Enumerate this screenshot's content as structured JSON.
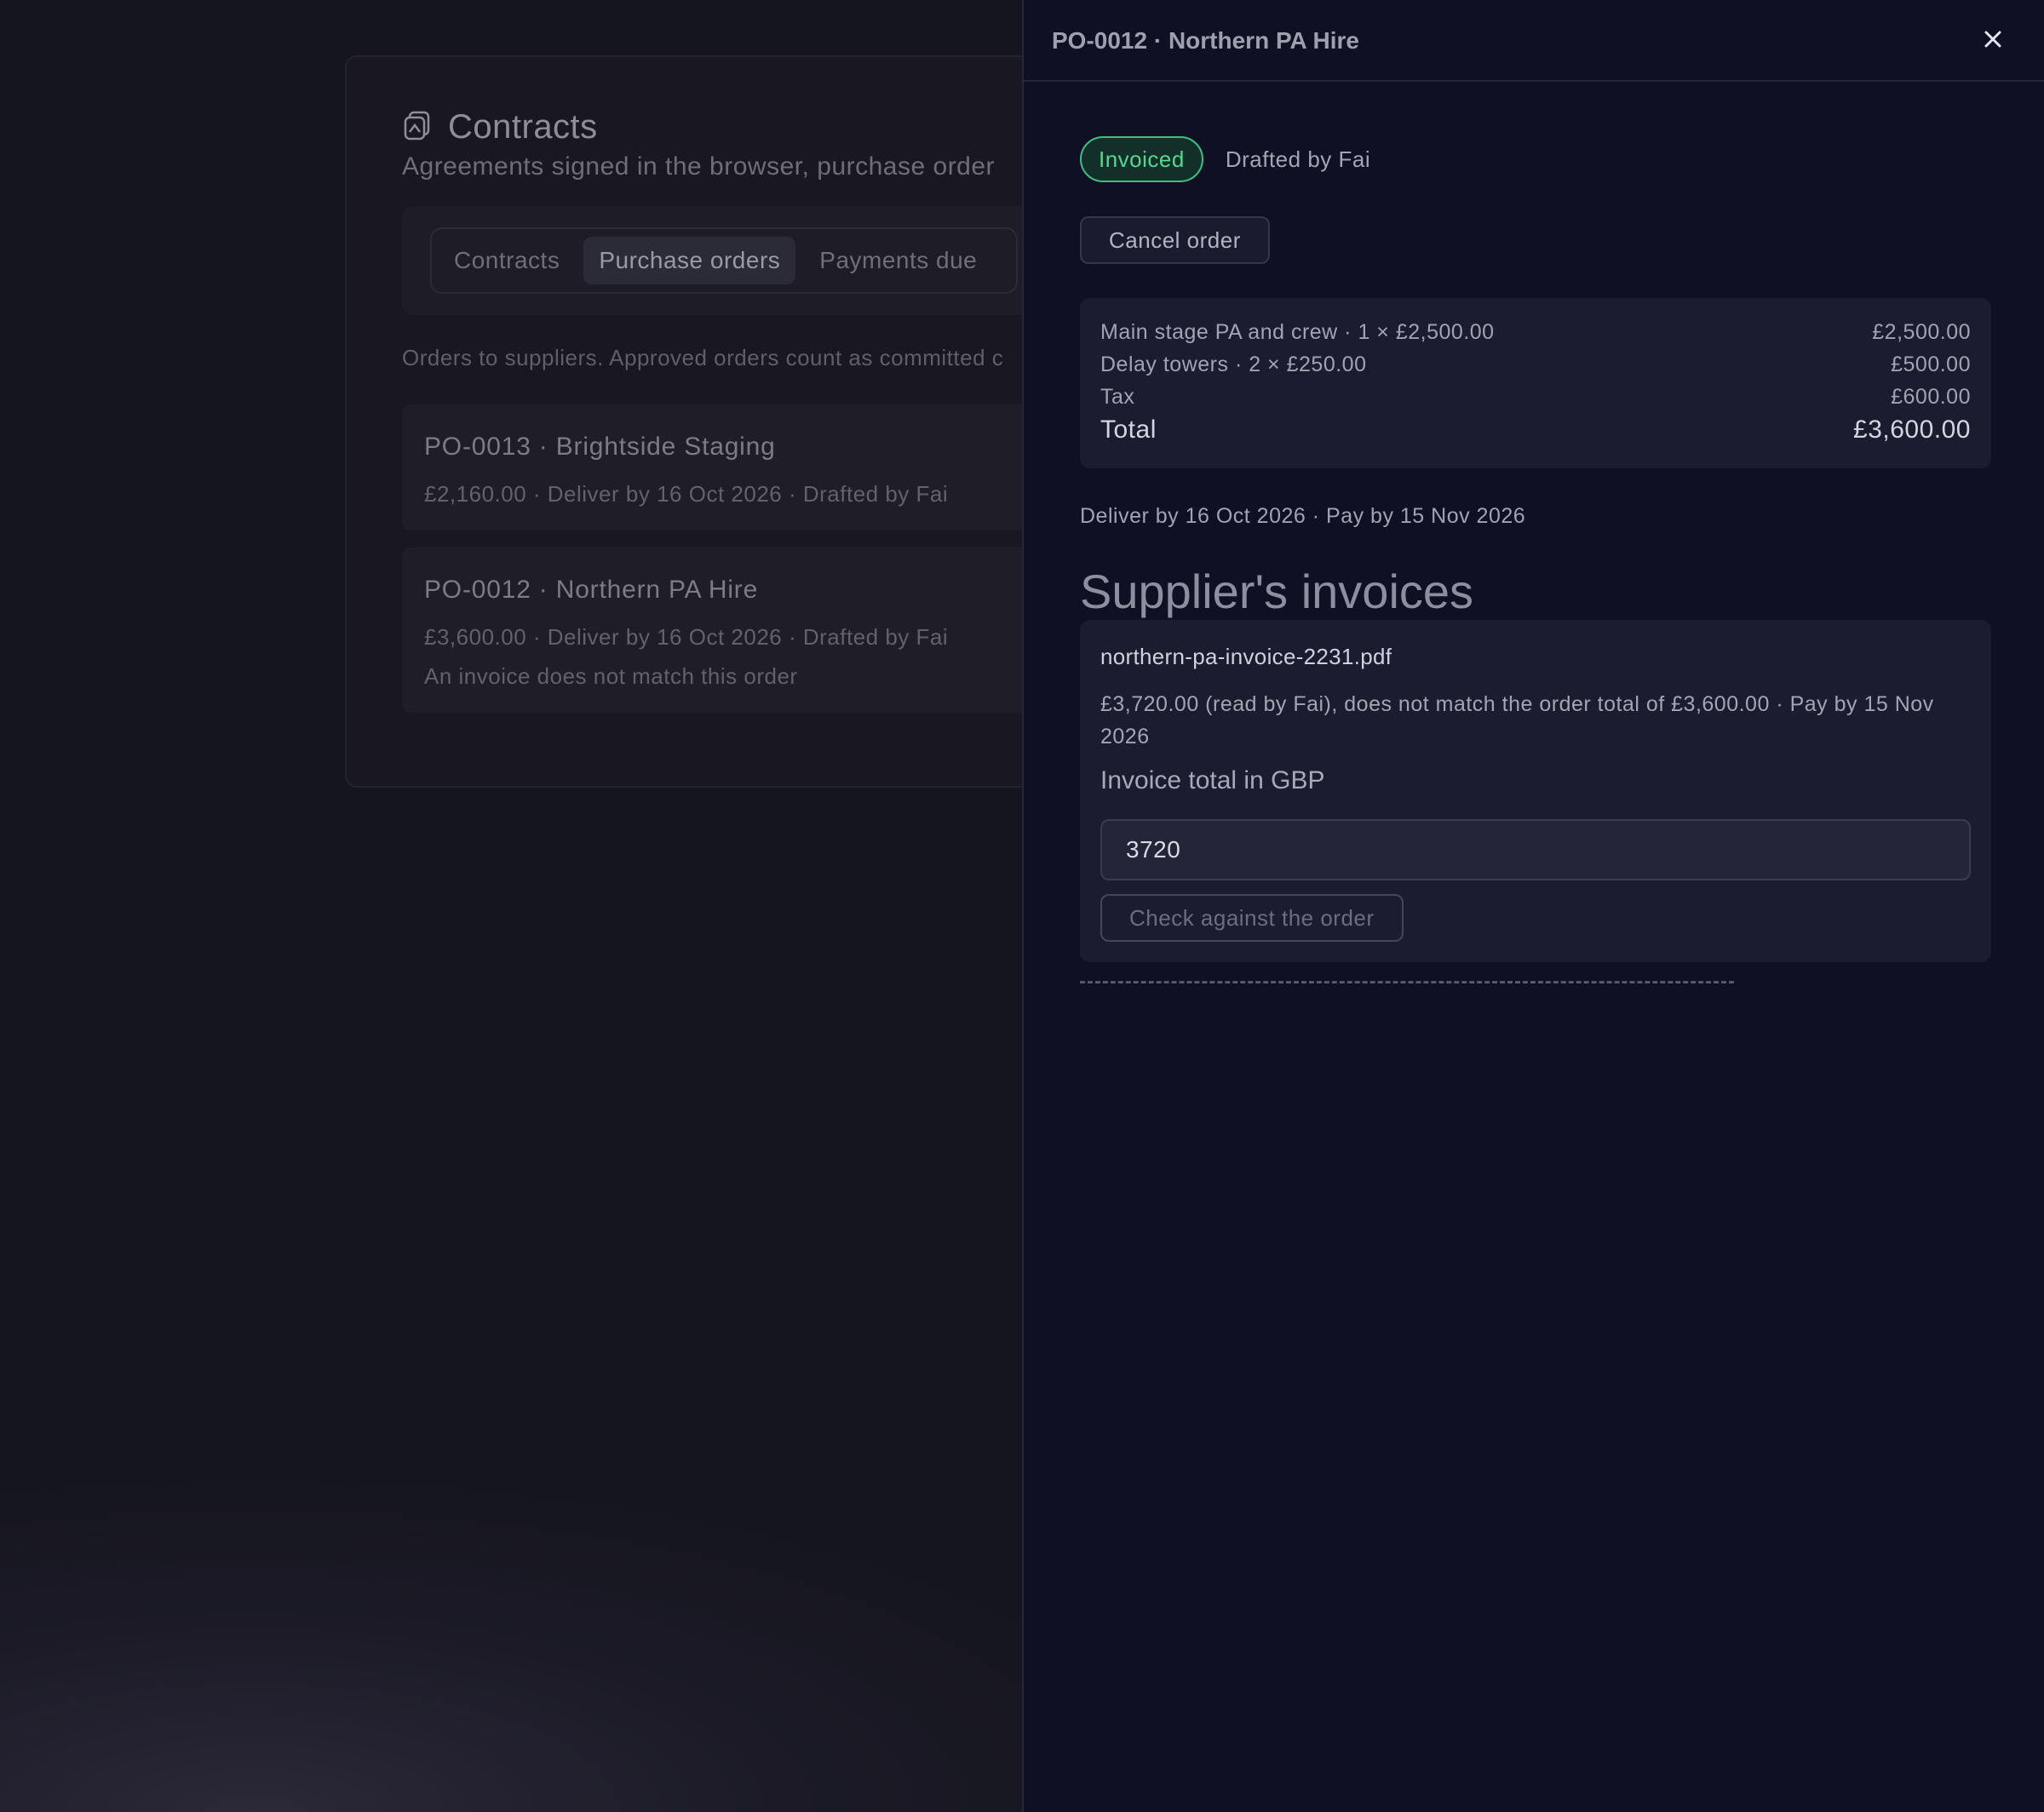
{
  "background": {
    "card": {
      "title": "Contracts",
      "subtitle": "Agreements signed in the browser, purchase order",
      "tabs": [
        "Contracts",
        "Purchase orders",
        "Payments due"
      ],
      "active_tab": "Purchase orders",
      "orders_description": "Orders to suppliers. Approved orders count as committed c",
      "orders": [
        {
          "title": "PO-0013 · Brightside Staging",
          "meta": "£2,160.00 · Deliver by 16 Oct 2026 · Drafted by Fai",
          "warning": ""
        },
        {
          "title": "PO-0012 · Northern PA Hire",
          "meta": "£3,600.00 · Deliver by 16 Oct 2026 · Drafted by Fai",
          "warning": "An invoice does not match this order"
        }
      ]
    }
  },
  "drawer": {
    "title": "PO-0012 · Northern PA Hire",
    "close_icon": "close-icon",
    "status": "Invoiced",
    "drafted": "Drafted by Fai",
    "cancel_label": "Cancel order",
    "lines": [
      {
        "label": "Main stage PA and crew · 1 × £2,500.00",
        "amount": "£2,500.00"
      },
      {
        "label": "Delay towers · 2 × £250.00",
        "amount": "£500.00"
      },
      {
        "label": "Tax",
        "amount": "£600.00"
      }
    ],
    "total": {
      "label": "Total",
      "amount": "£3,600.00"
    },
    "dates": "Deliver by 16 Oct 2026 · Pay by 15 Nov 2026",
    "invoices_heading": "Supplier's invoices",
    "invoice": {
      "file": "northern-pa-invoice-2231.pdf",
      "description": "£3,720.00 (read by Fai), does not match the order total of £3,600.00 · Pay by 15 Nov 2026",
      "field_label": "Invoice total in GBP",
      "field_value": "3720",
      "check_label": "Check against the order"
    }
  },
  "colors": {
    "drawer_bg": "#0f1024",
    "status_green": "#56d78f",
    "panel_bg": "#1b1c30"
  }
}
